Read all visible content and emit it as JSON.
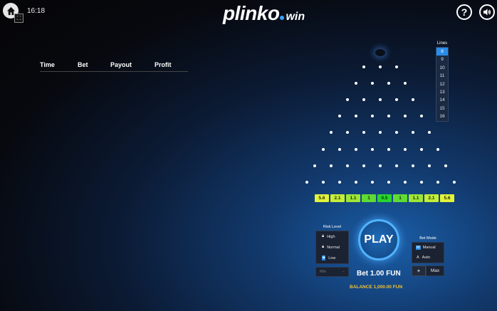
{
  "header": {
    "clock": "16:18",
    "logo_main": "plinko",
    "logo_suffix": "win",
    "help_label": "?",
    "sound_icon": "speaker-icon"
  },
  "history": {
    "columns": [
      "Time",
      "Bet",
      "Payout",
      "Profit"
    ]
  },
  "lines": {
    "title": "Lines",
    "options": [
      "8",
      "9",
      "10",
      "11",
      "12",
      "13",
      "14",
      "15",
      "16"
    ],
    "selected": "8"
  },
  "multipliers": [
    "5.6",
    "2.1",
    "1.1",
    "1",
    "0.5",
    "1",
    "1.1",
    "2.1",
    "5.6"
  ],
  "risk": {
    "title": "Risk Level",
    "options": [
      "High",
      "Normal",
      "Low"
    ],
    "selected": "Low",
    "bottom_left": "Min",
    "bottom_right": "−"
  },
  "play_label": "PLAY",
  "bet_text": "Bet 1.00 FUN",
  "balance_text": "BALANCE 1,000.00 FUN",
  "bet_mode": {
    "title": "Bet Mode",
    "options": [
      "Manual",
      "Auto"
    ],
    "selected": "Manual",
    "plus_label": "+",
    "max_label": "Max"
  },
  "colors": {
    "accent": "#2a8ce8",
    "balance": "#f2c230",
    "slot_edge": "#e3f23a",
    "slot_center": "#28d52f"
  }
}
